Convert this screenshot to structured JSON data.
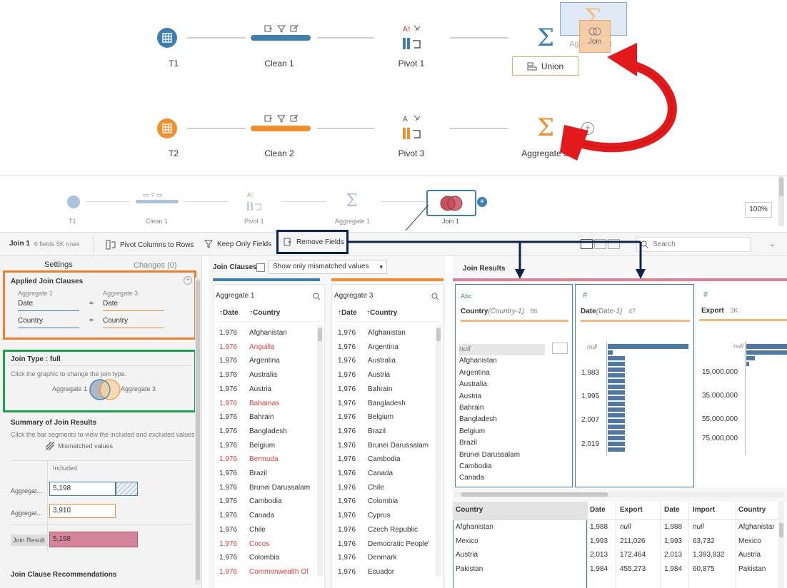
{
  "flow": {
    "row1": [
      "T1",
      "Clean 1",
      "Pivot 1"
    ],
    "row2": [
      "T2",
      "Clean 2",
      "Pivot 3",
      "Aggregate 3"
    ],
    "drag_ghost_label": "Aggregate 3",
    "drag_join_label": "Join",
    "union_label": "Union",
    "colors": {
      "blue": "#3e7fb1",
      "orange": "#f28e2b",
      "red": "#e31a1c"
    }
  },
  "mini_flow": {
    "nodes": [
      "T1",
      "Clean 1",
      "Pivot 1",
      "Aggregate 1",
      "Join 1"
    ],
    "zoom": "100%"
  },
  "toolbar": {
    "step_name": "Join 1",
    "step_info": "6 fields  5K rows",
    "pivot_label": "Pivot Columns to Rows",
    "keep_label": "Keep Only Fields",
    "remove_label": "Remove Fields",
    "search_placeholder": "Search"
  },
  "settings": {
    "tab_settings": "Settings",
    "tab_changes": "Changes (0)",
    "applied_title": "Applied Join Clauses",
    "left_source": "Aggregate 1",
    "right_source": "Aggregate 3",
    "clauses": [
      {
        "left": "Date",
        "op": "=",
        "right": "Date"
      },
      {
        "left": "Country",
        "op": "=",
        "right": "Country"
      }
    ],
    "join_type_title": "Join Type : full",
    "join_type_hint": "Click the graphic to change the join type.",
    "venn_left": "Aggregate 1",
    "venn_right": "Aggregate 3",
    "summary_title": "Summary of Join Results",
    "summary_hint": "Click the bar segments to view the included and excluded values.",
    "mismatched_label": "Mismatched values",
    "included_label": "Included",
    "rows": [
      {
        "label": "Aggregat...",
        "value": "5,198",
        "included_fraction": 0.75
      },
      {
        "label": "Aggregat...",
        "value": "3,910",
        "included_fraction": 0.75
      },
      {
        "label": "Join Result",
        "value": "5,198",
        "included_fraction": 1.0
      }
    ],
    "recommendations_title": "Join Clause Recommendations"
  },
  "join_clauses": {
    "title": "Join Clauses",
    "filter_label": "Show only mismatched values",
    "left": {
      "source": "Aggregate 1",
      "col_date": "Date",
      "col_country": "Country",
      "rows": [
        {
          "date": "1,976",
          "country": "Afghanistan",
          "mismatch": false
        },
        {
          "date": "1,976",
          "country": "Anguilla",
          "mismatch": true
        },
        {
          "date": "1,976",
          "country": "Argentina",
          "mismatch": false
        },
        {
          "date": "1,976",
          "country": "Australia",
          "mismatch": false
        },
        {
          "date": "1,976",
          "country": "Austria",
          "mismatch": false
        },
        {
          "date": "1,976",
          "country": "Bahamas",
          "mismatch": true
        },
        {
          "date": "1,976",
          "country": "Bahrain",
          "mismatch": false
        },
        {
          "date": "1,976",
          "country": "Bangladesh",
          "mismatch": false
        },
        {
          "date": "1,976",
          "country": "Belgium",
          "mismatch": false
        },
        {
          "date": "1,976",
          "country": "Bermuda",
          "mismatch": true
        },
        {
          "date": "1,976",
          "country": "Brazil",
          "mismatch": false
        },
        {
          "date": "1,976",
          "country": "Brunei Darussalam",
          "mismatch": false
        },
        {
          "date": "1,976",
          "country": "Cambodia",
          "mismatch": false
        },
        {
          "date": "1,976",
          "country": "Canada",
          "mismatch": false
        },
        {
          "date": "1,976",
          "country": "Chile",
          "mismatch": false
        },
        {
          "date": "1,976",
          "country": "Cocos",
          "mismatch": true
        },
        {
          "date": "1,976",
          "country": "Colombia",
          "mismatch": false
        },
        {
          "date": "1,976",
          "country": "Commonwealth Of",
          "mismatch": true
        }
      ]
    },
    "right": {
      "source": "Aggregate 3",
      "col_date": "Date",
      "col_country": "Country",
      "rows": [
        {
          "date": "1,976",
          "country": "Afghanistan"
        },
        {
          "date": "1,976",
          "country": "Argentina"
        },
        {
          "date": "1,976",
          "country": "Australia"
        },
        {
          "date": "1,976",
          "country": "Austria"
        },
        {
          "date": "1,976",
          "country": "Bahrain"
        },
        {
          "date": "1,976",
          "country": "Bangladesh"
        },
        {
          "date": "1,976",
          "country": "Belgium"
        },
        {
          "date": "1,976",
          "country": "Brazil"
        },
        {
          "date": "1,976",
          "country": "Brunei Darussalam"
        },
        {
          "date": "1,976",
          "country": "Cambodia"
        },
        {
          "date": "1,976",
          "country": "Canada"
        },
        {
          "date": "1,976",
          "country": "Chile"
        },
        {
          "date": "1,976",
          "country": "Colombia"
        },
        {
          "date": "1,976",
          "country": "Cyprus"
        },
        {
          "date": "1,976",
          "country": "Czech Republic"
        },
        {
          "date": "1,976",
          "country": "Democratic People'"
        },
        {
          "date": "1,976",
          "country": "Denmark"
        },
        {
          "date": "1,976",
          "country": "Ecuador"
        }
      ]
    }
  },
  "results": {
    "title": "Join Results",
    "cards": [
      {
        "type": "Abc",
        "name": "Country",
        "alias": "(Country-1)",
        "count": "86",
        "values": [
          "null",
          "Afghanistan",
          "Argentina",
          "Australia",
          "Austria",
          "Bahrain",
          "Bangladesh",
          "Belgium",
          "Brazil",
          "Brunei Darussalam",
          "Cambodia",
          "Canada"
        ]
      },
      {
        "type": "#",
        "name": "Date",
        "alias": "(Date-1)",
        "count": "47",
        "ticks": [
          "null",
          "1,983",
          "1,995",
          "2,007",
          "2,019"
        ]
      },
      {
        "type": "#",
        "name": "Export",
        "alias": "",
        "count": "3K",
        "ticks": [
          "null",
          "15,000,000",
          "35,000,000",
          "55,000,000",
          "75,000,000"
        ]
      }
    ],
    "grid": {
      "headers": [
        "Country",
        "Date",
        "Export",
        "Date",
        "Import",
        "Country"
      ],
      "rows": [
        [
          "Afghanistan",
          "1,988",
          "null",
          "1,988",
          "null",
          "Afghanistar"
        ],
        [
          "Mexico",
          "1,993",
          "211,026",
          "1,993",
          "63,732",
          "Mexico"
        ],
        [
          "Austria",
          "2,013",
          "172,464",
          "2,013",
          "1,393,832",
          "Austria"
        ],
        [
          "Pakistan",
          "1,984",
          "455,273",
          "1,984",
          "60,875",
          "Pakistan"
        ]
      ]
    }
  }
}
